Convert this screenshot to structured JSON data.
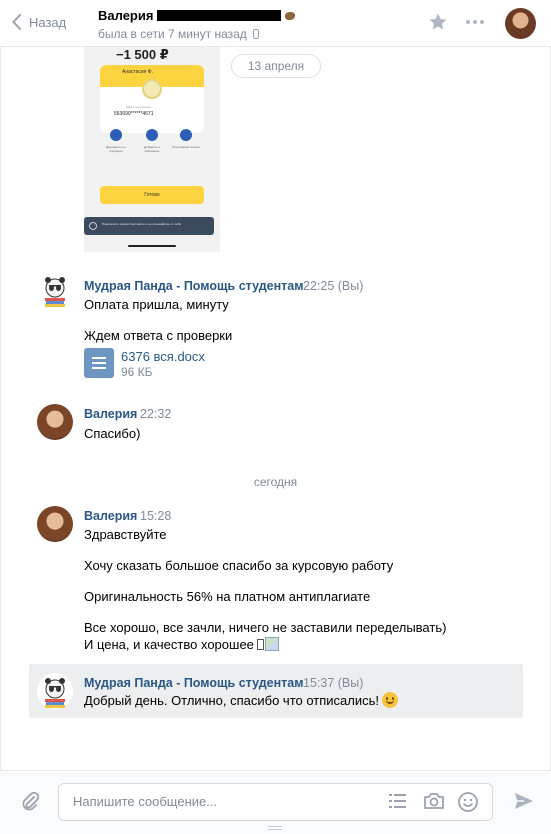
{
  "header": {
    "back_label": "Назад",
    "chat_name": "Валерия",
    "status": "была в сети 7 минут назад"
  },
  "attachment_image": {
    "price": "−1 500 ₽",
    "card_holder": "Анастасия Ф.",
    "card_label": "Карта получателя",
    "card_number": "553690******4671",
    "actions": [
      "Документы по операции",
      "Добавить в избранное",
      "Регулярный платеж"
    ],
    "done_button": "Готово",
    "toast_text": "Подключите сервис бесплатно и не отрывайтесь от себя"
  },
  "date_pill": "13 апреля",
  "messages": [
    {
      "author": "Мудрая Панда - Помощь студентам",
      "time": "22:25 (Вы)",
      "lines": [
        "Оплата пришла, минуту",
        "Ждем ответа с проверки"
      ],
      "document": {
        "name": "6376 вся.docx",
        "size": "96 КБ"
      }
    },
    {
      "author": "Валерия",
      "time": "22:32",
      "lines": [
        "Спасибо)"
      ]
    },
    {
      "author": "Валерия",
      "time": "15:28",
      "lines": [
        "Здравствуйте",
        "Хочу сказать большое спасибо за курсовую работу",
        "Оригинальность 56% на платном антиплагиате",
        "Все хорошо, все зачли, ничего не заставили переделывать)",
        "И цена, и качество хорошее"
      ]
    },
    {
      "author": "Мудрая Панда - Помощь студентам",
      "time": "15:37 (Вы)",
      "lines": [
        "Добрый день. Отлично, спасибо что отписались!"
      ]
    }
  ],
  "today_divider": "сегодня",
  "composer": {
    "placeholder": "Напишите сообщение..."
  },
  "colors": {
    "link": "#2a5885",
    "muted": "#818c99",
    "highlight_bg": "#edeef0"
  },
  "icons": [
    "chevron-left-icon",
    "star-icon",
    "more-icon",
    "phone-icon",
    "paperclip-icon",
    "list-icon",
    "camera-icon",
    "smile-icon",
    "send-icon",
    "document-icon"
  ]
}
